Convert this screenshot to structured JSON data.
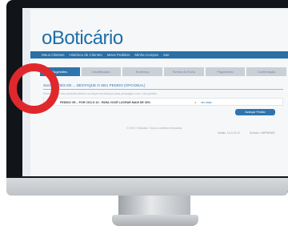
{
  "brand": {
    "logo_text": "oBoticário"
  },
  "navbar": {
    "items": [
      "Meus Clientes",
      "Histórico de Clientes",
      "Meus Pedidos",
      "Minha Compra",
      "Sair"
    ]
  },
  "steps": [
    "Sugestões",
    "Identificação",
    "Endereço",
    "Forma de Envio",
    "Pagamento",
    "Confirmação"
  ],
  "offer_section": {
    "title": "SUGESTÕES DE ... DESTAQUE O SEU PEDIDO (OPCIONAL)",
    "instruction": "Selecione um dos produtos abaixo ou clique em Avançar para prosseguir com o seu pedido",
    "offer": {
      "label": "PEDIDO VE... POR CICLO 10 - PARA VOCÊ LUCRAR MAIS DE 30%",
      "see_link": "ver mais"
    },
    "advance_label": "Avançar Pedido"
  },
  "footer": {
    "copyright": "© 2015 O Boticário. Todos os direitos reservados.",
    "version_label": "Versão: 2.0.0.12.10",
    "server_label": "Servidor: VMPWEB05"
  },
  "colors": {
    "brand_blue": "#2f74ad",
    "highlight_circle": "#e0282c"
  }
}
